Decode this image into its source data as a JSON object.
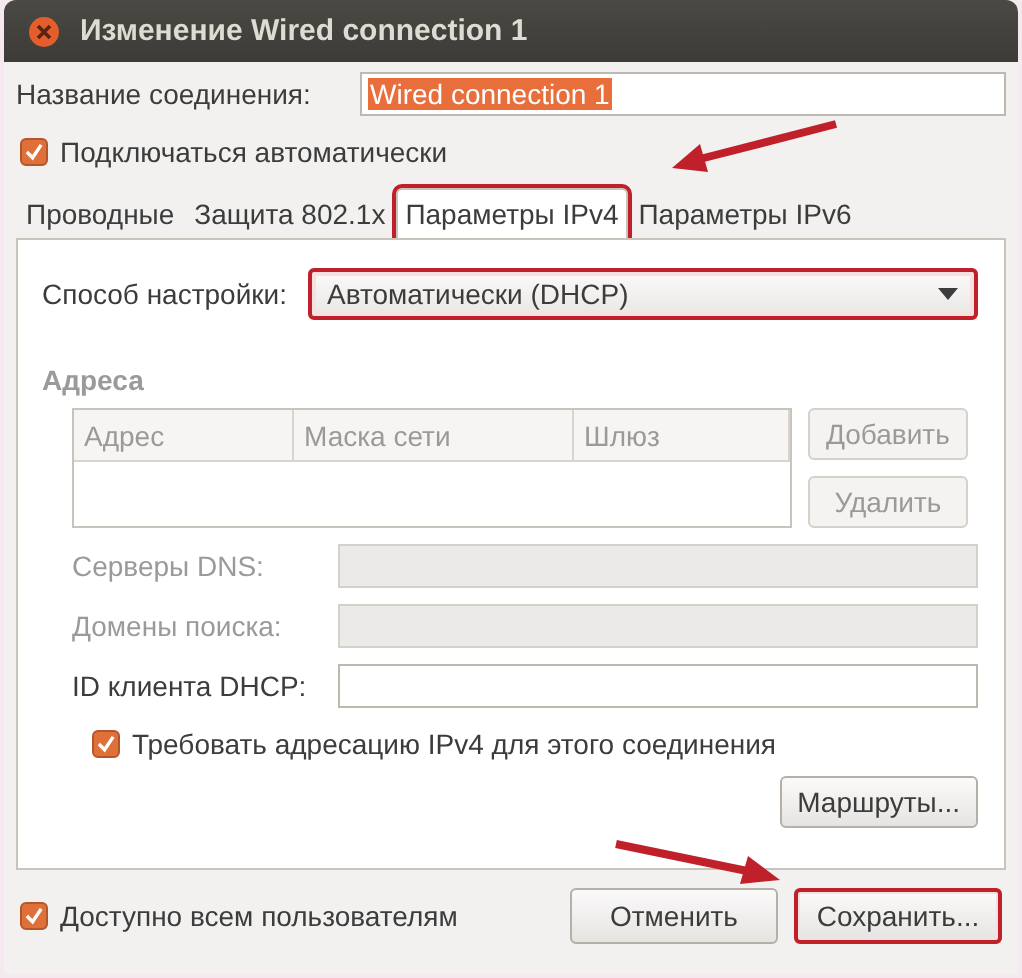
{
  "window": {
    "title": "Изменение Wired connection 1"
  },
  "connection_name": {
    "label": "Название соединения:",
    "value": "Wired connection 1",
    "selected": true
  },
  "connect_automatically": {
    "label": "Подключаться автоматически",
    "checked": true
  },
  "tabs": [
    {
      "label": "Проводные",
      "selected": false,
      "highlighted": false
    },
    {
      "label": "Защита 802.1x",
      "selected": false,
      "highlighted": false
    },
    {
      "label": "Параметры IPv4",
      "selected": true,
      "highlighted": true
    },
    {
      "label": "Параметры IPv6",
      "selected": false,
      "highlighted": false
    }
  ],
  "ipv4": {
    "method": {
      "label": "Способ настройки:",
      "value": "Автоматически (DHCP)",
      "highlighted": true
    },
    "addresses": {
      "title": "Адреса",
      "disabled": true,
      "columns": [
        "Адрес",
        "Маска сети",
        "Шлюз"
      ],
      "buttons": [
        {
          "label": "Добавить",
          "disabled": true
        },
        {
          "label": "Удалить",
          "disabled": true
        }
      ]
    },
    "fields": [
      {
        "label": "Серверы DNS:",
        "disabled": true
      },
      {
        "label": "Домены поиска:",
        "disabled": true
      },
      {
        "label": "ID клиента DHCP:",
        "disabled": false
      }
    ],
    "require_ipv4": {
      "label": "Требовать адресацию IPv4 для этого соединения",
      "checked": true
    },
    "routes_button": {
      "label": "Маршруты...",
      "disabled": false
    }
  },
  "available_to_all": {
    "label": "Доступно всем пользователям",
    "checked": true
  },
  "buttons": [
    {
      "label": "Отменить",
      "highlighted": false
    },
    {
      "label": "Сохранить...",
      "highlighted": true
    }
  ]
}
